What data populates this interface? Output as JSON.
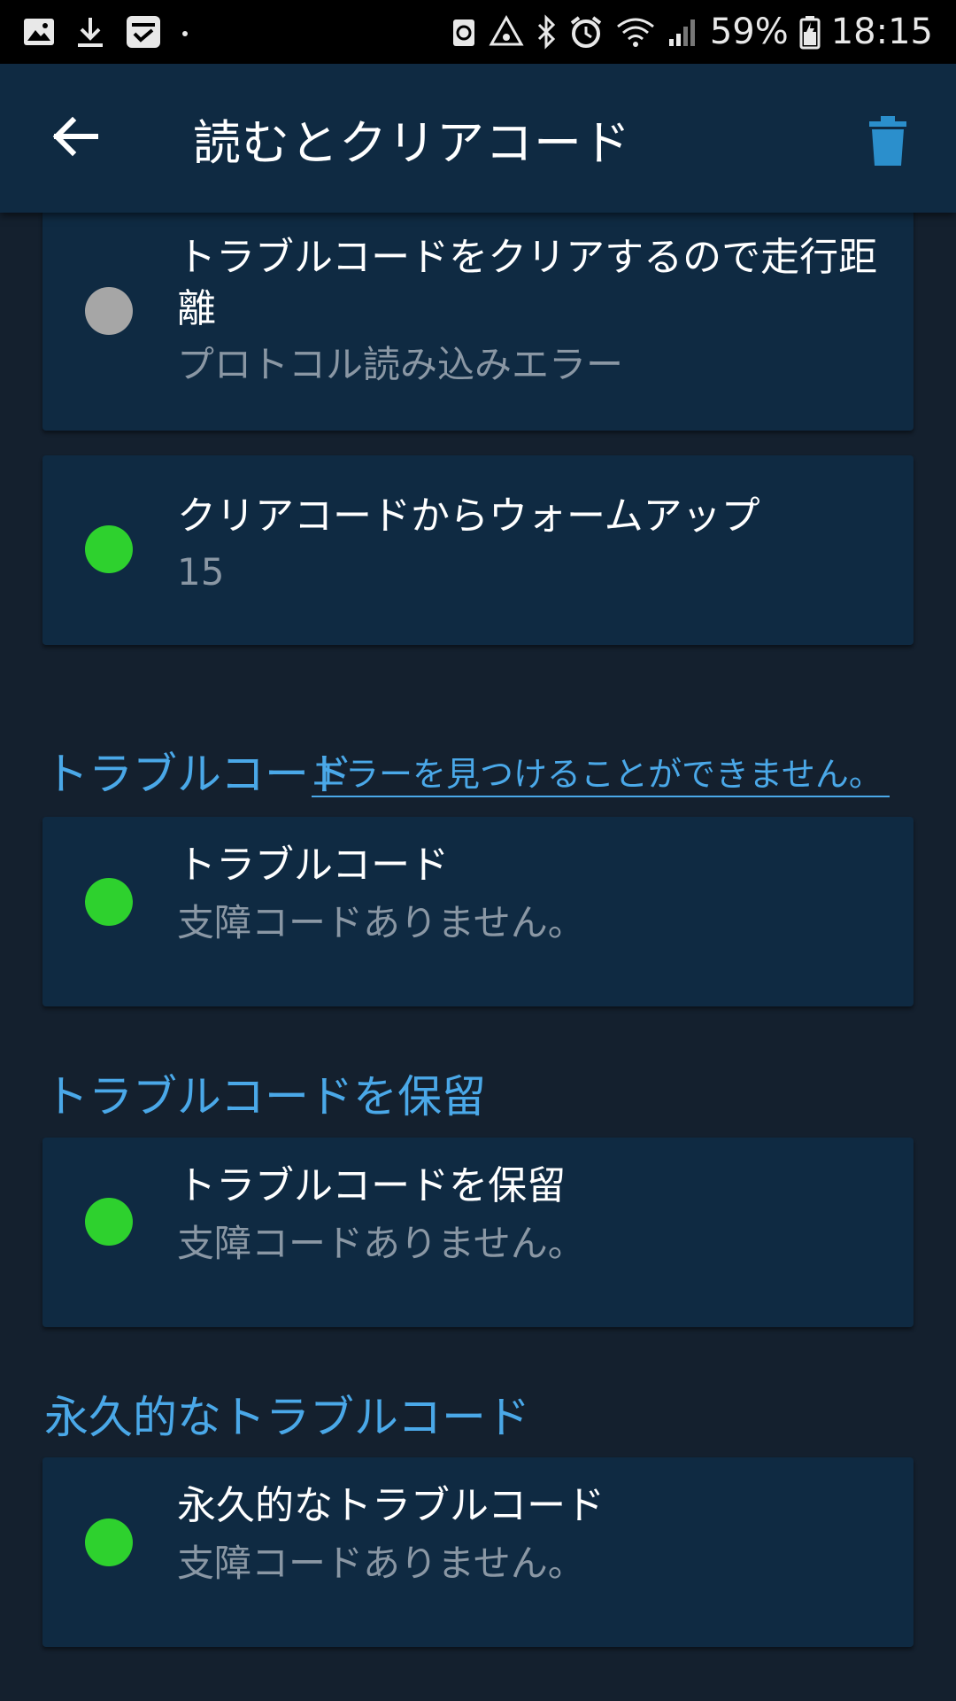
{
  "status_bar": {
    "left_icons": [
      "gallery-icon",
      "download-icon",
      "clipboard-icon",
      "dot"
    ],
    "right_icons": [
      "recycle-icon",
      "warning-icon",
      "bluetooth-icon",
      "alarm-icon",
      "wifi-icon",
      "signal-icon"
    ],
    "battery_percent": "59%",
    "time": "18:15"
  },
  "app_bar": {
    "title": "読むとクリアコード",
    "back_icon": "arrow-left-icon",
    "trash_icon": "trash-icon",
    "accent_color": "#2b8fcc"
  },
  "cards": [
    {
      "title": "トラブルコードをクリアするので走行距離",
      "subtitle": "プロトコル読み込みエラー",
      "status_color": "#a6a6a6"
    },
    {
      "title": "クリアコードからウォームアップ",
      "subtitle": "15",
      "status_color": "#2ed12e"
    }
  ],
  "sections": [
    {
      "header": "トラブルコード",
      "error_link": "エラーを見つけることができません。",
      "card": {
        "title": "トラブルコード",
        "subtitle": "支障コードありません。",
        "status_color": "#2ed12e"
      }
    },
    {
      "header": "トラブルコードを保留",
      "card": {
        "title": "トラブルコードを保留",
        "subtitle": "支障コードありません。",
        "status_color": "#2ed12e"
      }
    },
    {
      "header": "永久的なトラブルコード",
      "card": {
        "title": "永久的なトラブルコード",
        "subtitle": "支障コードありません。",
        "status_color": "#2ed12e"
      }
    }
  ]
}
